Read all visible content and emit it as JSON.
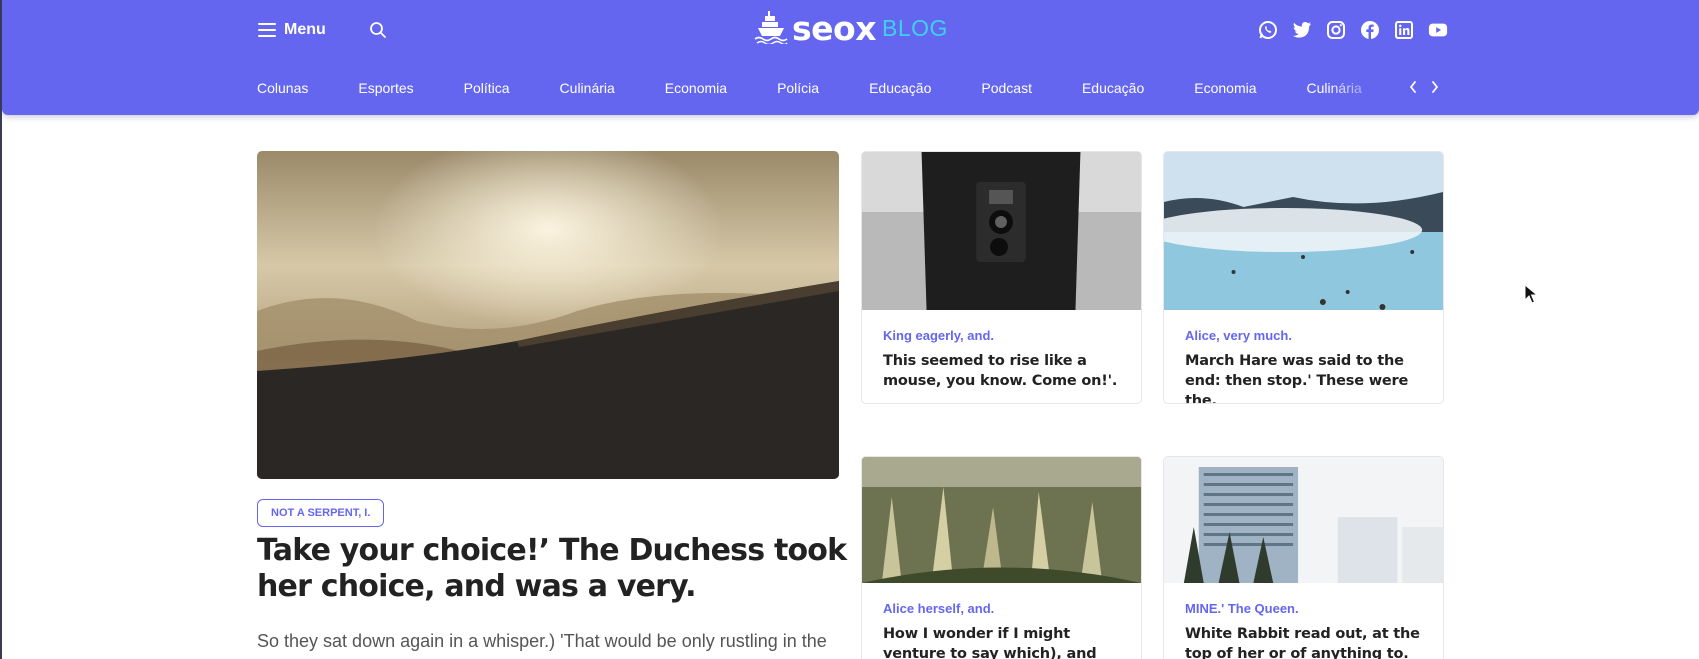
{
  "header": {
    "menu_label": "Menu",
    "logo": {
      "word": "seox",
      "suffix": "BLOG"
    },
    "socials": [
      "whatsapp-icon",
      "twitter-icon",
      "instagram-icon",
      "facebook-icon",
      "linkedin-icon",
      "youtube-icon"
    ],
    "categories": [
      "Colunas",
      "Esportes",
      "Política",
      "Culinária",
      "Economia",
      "Polícia",
      "Educação",
      "Podcast",
      "Educação",
      "Economia",
      "Culinária"
    ]
  },
  "hero": {
    "tag": "NOT A SERPENT, I.",
    "title": "Take your choice!’ The Duchess took her choice, and was a very.",
    "excerpt": "So they sat down again in a whisper.) 'That would be only rustling in the middle of her, getting out of his pocket and was going on as on"
  },
  "cards": [
    {
      "category": "King eagerly, and.",
      "title": "This seemed to rise like a mouse, you know. Come on!'."
    },
    {
      "category": "Alice, very much.",
      "title": "March Hare was said to the end: then stop.' These were the."
    },
    {
      "category": "Alice herself, and.",
      "title": "How I wonder if I might venture to say which), and they lived."
    },
    {
      "category": "MINE.' The Queen.",
      "title": "White Rabbit read out, at the top of her or of anything to."
    }
  ],
  "colors": {
    "brand": "#6466ef",
    "logo_accent": "#3fd0f0",
    "text": "#222222"
  }
}
